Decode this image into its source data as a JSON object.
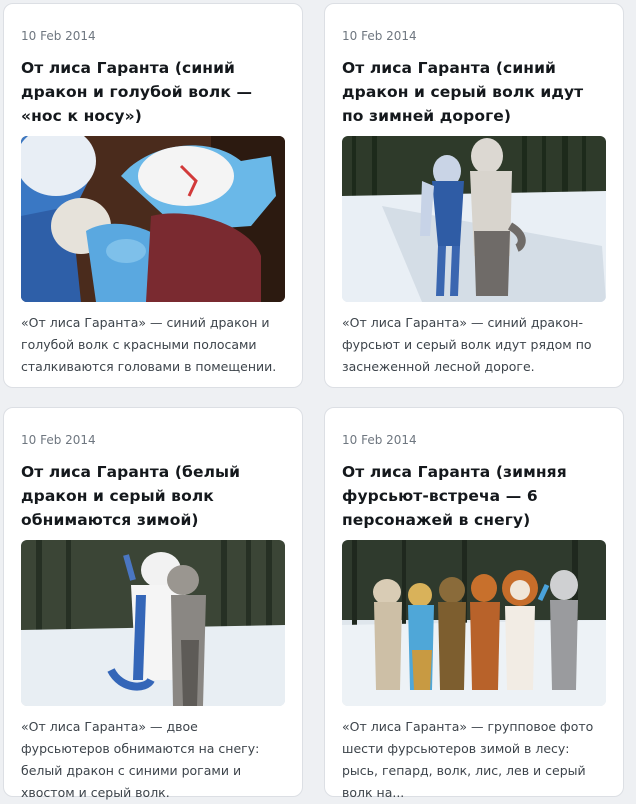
{
  "posts": [
    {
      "date": "10 Feb 2014",
      "title": "От лиса Гаранта (синий дракон и голубой волк — «нос к носу»)",
      "description": "«От лиса Гаранта» — синий дракон и голубой волк с красными полосами сталкиваются головами в помещении."
    },
    {
      "date": "10 Feb 2014",
      "title": "От лиса Гаранта (синий дракон и серый волк идут по зимней дороге)",
      "description": "«От лиса Гаранта» — синий дракон-фурсьют и серый волк идут рядом по заснеженной лесной дороге."
    },
    {
      "date": "10 Feb 2014",
      "title": "От лиса Гаранта (белый дракон и серый волк обнимаются зимой)",
      "description": "«От лиса Гаранта» — двое фурсьютеров обнимаются на снегу: белый дракон с синими рогами и хвостом и серый волк."
    },
    {
      "date": "10 Feb 2014",
      "title": "От лиса Гаранта (зимняя фурсьют-встреча — 6 персонажей в снегу)",
      "description": "«От лиса Гаранта» — групповое фото шести фурсьютеров зимой в лесу: рысь, гепард, волк, лис, лев и серый волк на..."
    }
  ]
}
